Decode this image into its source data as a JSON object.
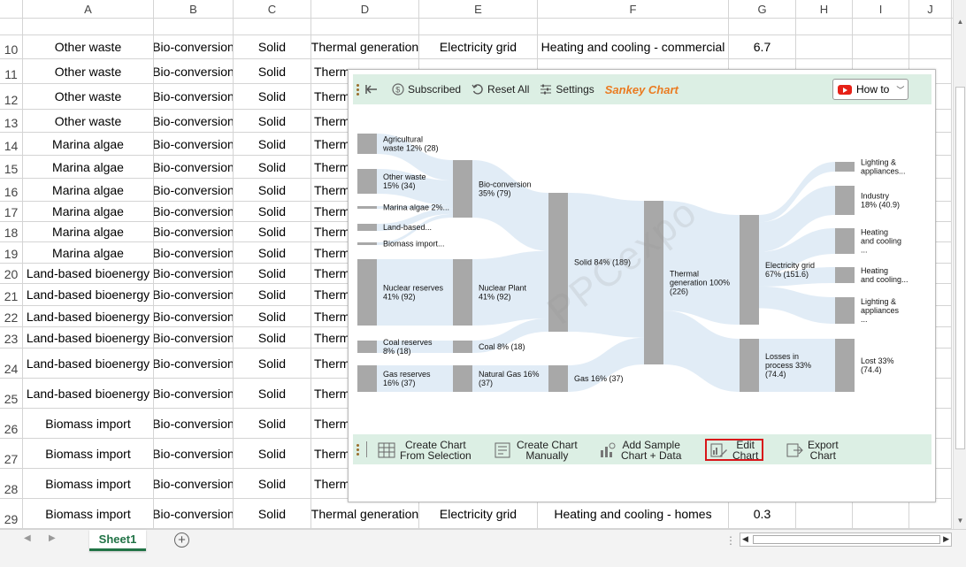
{
  "sheet": {
    "columns": [
      "A",
      "B",
      "C",
      "D",
      "E",
      "F",
      "G",
      "H",
      "I",
      "J"
    ],
    "rows": [
      {
        "num": "10",
        "cells": [
          "Other waste",
          "Bio-conversion",
          "Solid",
          "Thermal generation",
          "Electricity grid",
          "Heating and cooling - commercial",
          "6.7"
        ]
      },
      {
        "num": "11",
        "cells": [
          "Other waste",
          "Bio-conversion",
          "Solid",
          "Therm",
          "",
          "",
          ""
        ]
      },
      {
        "num": "12",
        "cells": [
          "Other waste",
          "Bio-conversion",
          "Solid",
          "Therm",
          "",
          "",
          ""
        ]
      },
      {
        "num": "13",
        "cells": [
          "Other waste",
          "Bio-conversion",
          "Solid",
          "Therm",
          "",
          "",
          ""
        ]
      },
      {
        "num": "14",
        "cells": [
          "Marina algae",
          "Bio-conversion",
          "Solid",
          "Therm",
          "",
          "",
          ""
        ]
      },
      {
        "num": "15",
        "cells": [
          "Marina algae",
          "Bio-conversion",
          "Solid",
          "Therm",
          "",
          "",
          ""
        ]
      },
      {
        "num": "16",
        "cells": [
          "Marina algae",
          "Bio-conversion",
          "Solid",
          "Therm",
          "",
          "",
          ""
        ]
      },
      {
        "num": "17",
        "cells": [
          "Marina algae",
          "Bio-conversion",
          "Solid",
          "Therm",
          "",
          "",
          ""
        ]
      },
      {
        "num": "18",
        "cells": [
          "Marina algae",
          "Bio-conversion",
          "Solid",
          "Therm",
          "",
          "",
          ""
        ]
      },
      {
        "num": "19",
        "cells": [
          "Marina algae",
          "Bio-conversion",
          "Solid",
          "Therm",
          "",
          "",
          ""
        ]
      },
      {
        "num": "20",
        "cells": [
          "Land-based bioenergy",
          "Bio-conversion",
          "Solid",
          "Therm",
          "",
          "",
          ""
        ]
      },
      {
        "num": "21",
        "cells": [
          "Land-based bioenergy",
          "Bio-conversion",
          "Solid",
          "Therm",
          "",
          "",
          ""
        ]
      },
      {
        "num": "22",
        "cells": [
          "Land-based bioenergy",
          "Bio-conversion",
          "Solid",
          "Therm",
          "",
          "",
          ""
        ]
      },
      {
        "num": "23",
        "cells": [
          "Land-based bioenergy",
          "Bio-conversion",
          "Solid",
          "Therm",
          "",
          "",
          ""
        ]
      },
      {
        "num": "24",
        "cells": [
          "Land-based bioenergy",
          "Bio-conversion",
          "Solid",
          "Therm",
          "",
          "",
          ""
        ]
      },
      {
        "num": "25",
        "cells": [
          "Land-based bioenergy",
          "Bio-conversion",
          "Solid",
          "Therm",
          "",
          "",
          ""
        ]
      },
      {
        "num": "26",
        "cells": [
          "Biomass import",
          "Bio-conversion",
          "Solid",
          "Therm",
          "",
          "",
          ""
        ]
      },
      {
        "num": "27",
        "cells": [
          "Biomass import",
          "Bio-conversion",
          "Solid",
          "Therm",
          "",
          "",
          ""
        ]
      },
      {
        "num": "28",
        "cells": [
          "Biomass import",
          "Bio-conversion",
          "Solid",
          "Therm",
          "",
          "",
          ""
        ]
      },
      {
        "num": "29",
        "cells": [
          "Biomass import",
          "Bio-conversion",
          "Solid",
          "Thermal generation",
          "Electricity grid",
          "Heating and cooling - homes",
          "0.3"
        ]
      }
    ],
    "sheet_tab": "Sheet1"
  },
  "dialog": {
    "toolbar": {
      "subscribed": "Subscribed",
      "reset_all": "Reset All",
      "settings": "Settings",
      "title": "Sankey Chart",
      "how_to": "How to"
    },
    "bottom_toolbar": {
      "create_selection_1": "Create Chart",
      "create_selection_2": "From Selection",
      "create_manual_1": "Create Chart",
      "create_manual_2": "Manually",
      "add_sample_1": "Add Sample",
      "add_sample_2": "Chart + Data",
      "edit_chart_1": "Edit",
      "edit_chart_2": "Chart",
      "export_1": "Export",
      "export_2": "Chart"
    },
    "watermark": "PPCexpo"
  },
  "chart_data": {
    "type": "sankey",
    "nodes": [
      {
        "id": "agri",
        "label": [
          "Agricultural",
          "waste 12% (28)"
        ],
        "value": 28
      },
      {
        "id": "other",
        "label": [
          "Other waste",
          "15% (34)"
        ],
        "value": 34
      },
      {
        "id": "marina",
        "label": [
          "Marina algae 2%..."
        ],
        "value": 4
      },
      {
        "id": "land",
        "label": [
          "Land-based..."
        ],
        "value": 8
      },
      {
        "id": "biomass",
        "label": [
          "Biomass import..."
        ],
        "value": 5
      },
      {
        "id": "nuclear_res",
        "label": [
          "Nuclear reserves",
          "41% (92)"
        ],
        "value": 92
      },
      {
        "id": "coal_res",
        "label": [
          "Coal reserves",
          "8% (18)"
        ],
        "value": 18
      },
      {
        "id": "gas_res",
        "label": [
          "Gas reserves",
          "16% (37)"
        ],
        "value": 37
      },
      {
        "id": "bio",
        "label": [
          "Bio-conversion",
          "35% (79)"
        ],
        "value": 79
      },
      {
        "id": "nuclear_plant",
        "label": [
          "Nuclear Plant",
          "41% (92)"
        ],
        "value": 92
      },
      {
        "id": "coal",
        "label": [
          "Coal 8% (18)"
        ],
        "value": 18
      },
      {
        "id": "natgas",
        "label": [
          "Natural Gas 16%",
          "(37)"
        ],
        "value": 37
      },
      {
        "id": "solid",
        "label": [
          "Solid 84% (189)"
        ],
        "value": 189
      },
      {
        "id": "gas",
        "label": [
          "Gas 16% (37)"
        ],
        "value": 37
      },
      {
        "id": "thermal",
        "label": [
          "Thermal",
          "generation 100%",
          "(226)"
        ],
        "value": 226
      },
      {
        "id": "grid",
        "label": [
          "Electricity grid",
          "67% (151.6)"
        ],
        "value": 151.6
      },
      {
        "id": "losses",
        "label": [
          "Losses in",
          "process 33%",
          "(74.4)"
        ],
        "value": 74.4
      },
      {
        "id": "lighting1",
        "label": [
          "Lighting &",
          "appliances..."
        ],
        "value": 10
      },
      {
        "id": "industry",
        "label": [
          "Industry",
          "18% (40.9)"
        ],
        "value": 40.9
      },
      {
        "id": "heating1",
        "label": [
          "Heating",
          "and cooling",
          "..."
        ],
        "value": 30
      },
      {
        "id": "heating2",
        "label": [
          "Heating",
          "and cooling..."
        ],
        "value": 18
      },
      {
        "id": "lighting2",
        "label": [
          "Lighting &",
          "appliances",
          "..."
        ],
        "value": 30
      },
      {
        "id": "lost",
        "label": [
          "Lost 33%",
          "(74.4)"
        ],
        "value": 74.4
      }
    ],
    "links": [
      {
        "source": "agri",
        "target": "bio",
        "value": 28
      },
      {
        "source": "other",
        "target": "bio",
        "value": 34
      },
      {
        "source": "marina",
        "target": "bio",
        "value": 4
      },
      {
        "source": "land",
        "target": "bio",
        "value": 8
      },
      {
        "source": "biomass",
        "target": "bio",
        "value": 5
      },
      {
        "source": "nuclear_res",
        "target": "nuclear_plant",
        "value": 92
      },
      {
        "source": "coal_res",
        "target": "coal",
        "value": 18
      },
      {
        "source": "gas_res",
        "target": "natgas",
        "value": 37
      },
      {
        "source": "bio",
        "target": "solid",
        "value": 79
      },
      {
        "source": "nuclear_plant",
        "target": "solid",
        "value": 92
      },
      {
        "source": "coal",
        "target": "solid",
        "value": 18
      },
      {
        "source": "natgas",
        "target": "gas",
        "value": 37
      },
      {
        "source": "solid",
        "target": "thermal",
        "value": 189
      },
      {
        "source": "gas",
        "target": "thermal",
        "value": 37
      },
      {
        "source": "thermal",
        "target": "grid",
        "value": 151.6
      },
      {
        "source": "thermal",
        "target": "losses",
        "value": 74.4
      },
      {
        "source": "grid",
        "target": "lighting1",
        "value": 10
      },
      {
        "source": "grid",
        "target": "industry",
        "value": 40.9
      },
      {
        "source": "grid",
        "target": "heating1",
        "value": 30
      },
      {
        "source": "grid",
        "target": "heating2",
        "value": 18
      },
      {
        "source": "grid",
        "target": "lighting2",
        "value": 30
      },
      {
        "source": "losses",
        "target": "lost",
        "value": 74.4
      }
    ]
  }
}
